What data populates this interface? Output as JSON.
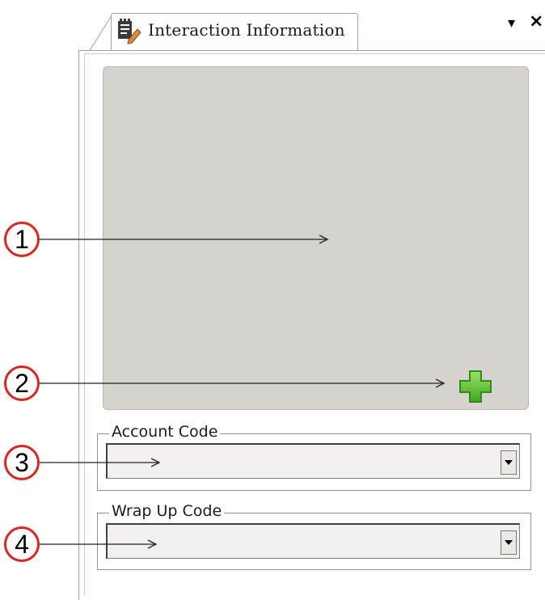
{
  "tab": {
    "title": "Interaction Information",
    "icon": "notepad-edit-icon",
    "menu_glyph": "▾",
    "close_glyph": "×"
  },
  "panel": {
    "add_icon": "green-plus-icon",
    "account_code": {
      "label": "Account Code",
      "value": ""
    },
    "wrap_up_code": {
      "label": "Wrap Up Code",
      "value": ""
    }
  },
  "callouts": [
    "1",
    "2",
    "3",
    "4"
  ],
  "colors": {
    "callout_ring": "#e0241a",
    "panel_gray": "#d6d3ce",
    "plus_green": "#5cc531"
  }
}
